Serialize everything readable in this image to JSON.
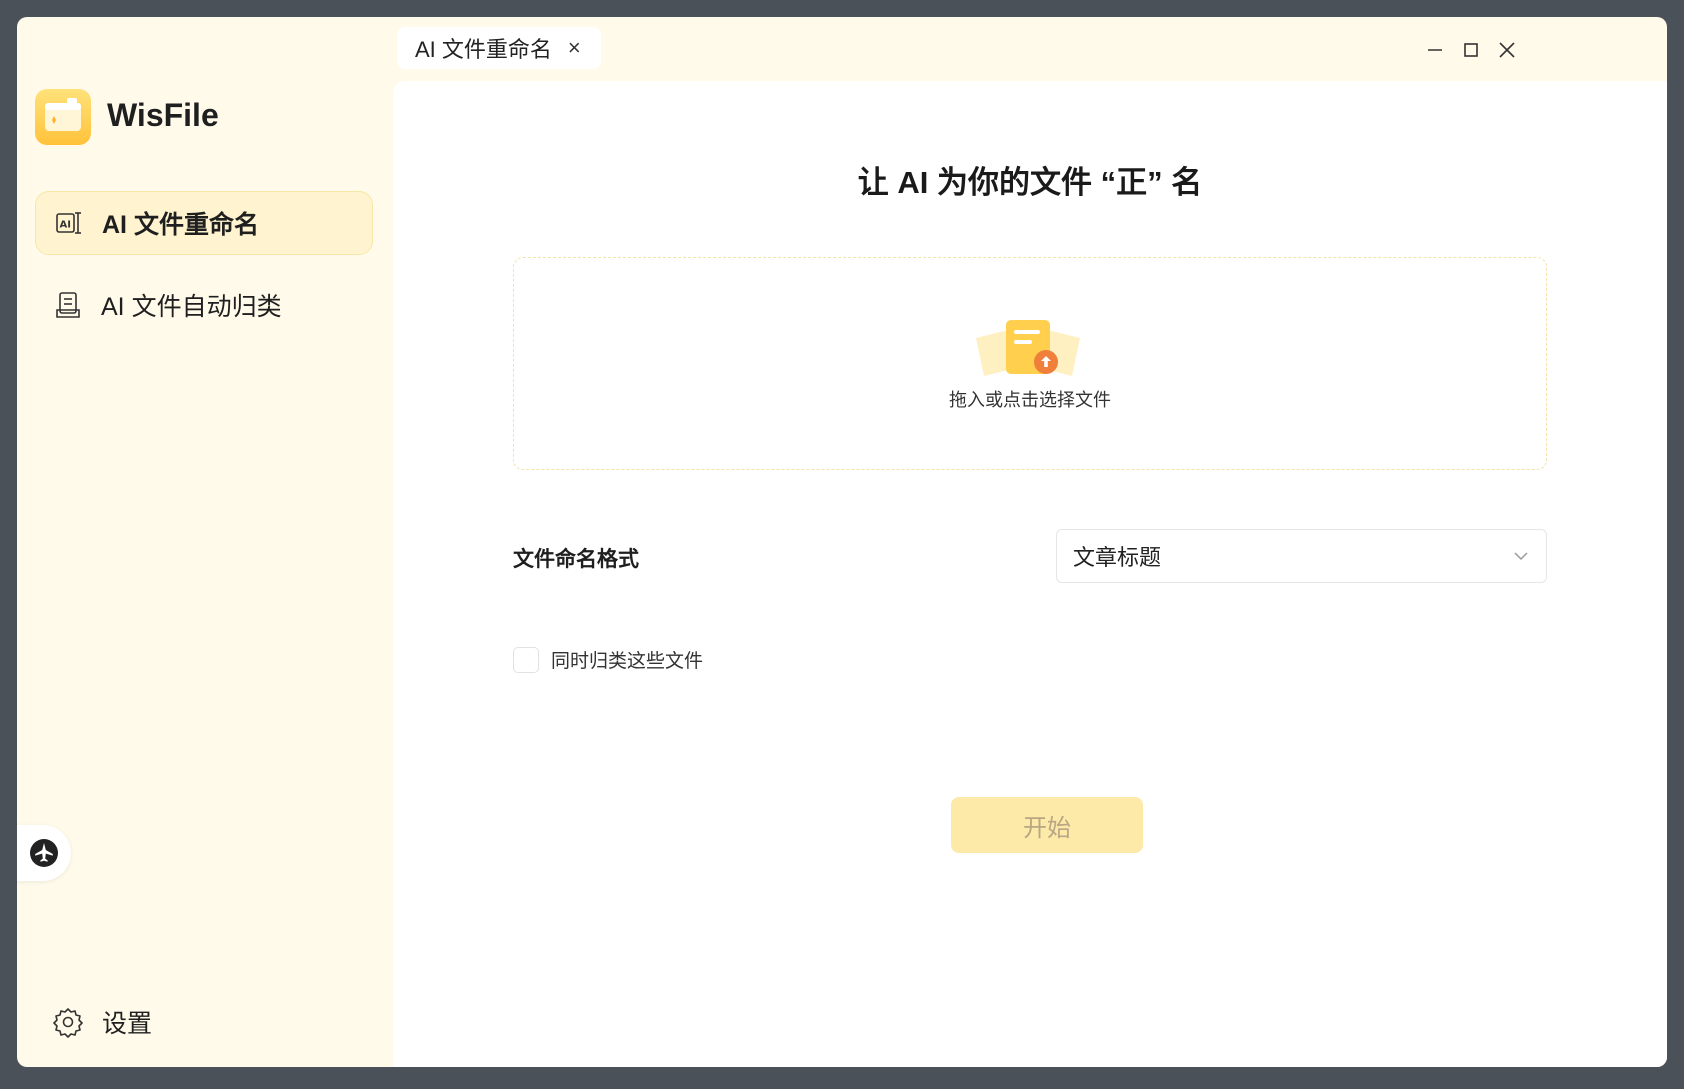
{
  "app": {
    "name": "WisFile"
  },
  "titlebar": {
    "tab_label": "AI 文件重命名",
    "tab_close": "×",
    "controls": [
      "minimize-icon",
      "maximize-icon",
      "close-icon"
    ]
  },
  "sidebar": {
    "items": [
      {
        "label": "AI 文件重命名",
        "icon": "ai-rename-icon",
        "active": true
      },
      {
        "label": "AI 文件自动归类",
        "icon": "document-classify-icon",
        "active": false
      }
    ],
    "settings_label": "设置",
    "float_icon": "airplane-icon"
  },
  "main": {
    "title": "让 AI 为你的文件 “正” 名",
    "dropzone": {
      "text": "拖入或点击选择文件",
      "icon": "file-upload-icon"
    },
    "format_label": "文件命名格式",
    "format_select": {
      "value": "文章标题"
    },
    "checkbox_label": "同时归类这些文件",
    "start_button": "开始"
  },
  "colors": {
    "window_bg": "#fffaea",
    "active_nav_bg": "#fff4cf",
    "start_button_bg": "#fde9a8",
    "accent_orange": "#f07f3c",
    "accent_yellow": "#ffd25a"
  }
}
